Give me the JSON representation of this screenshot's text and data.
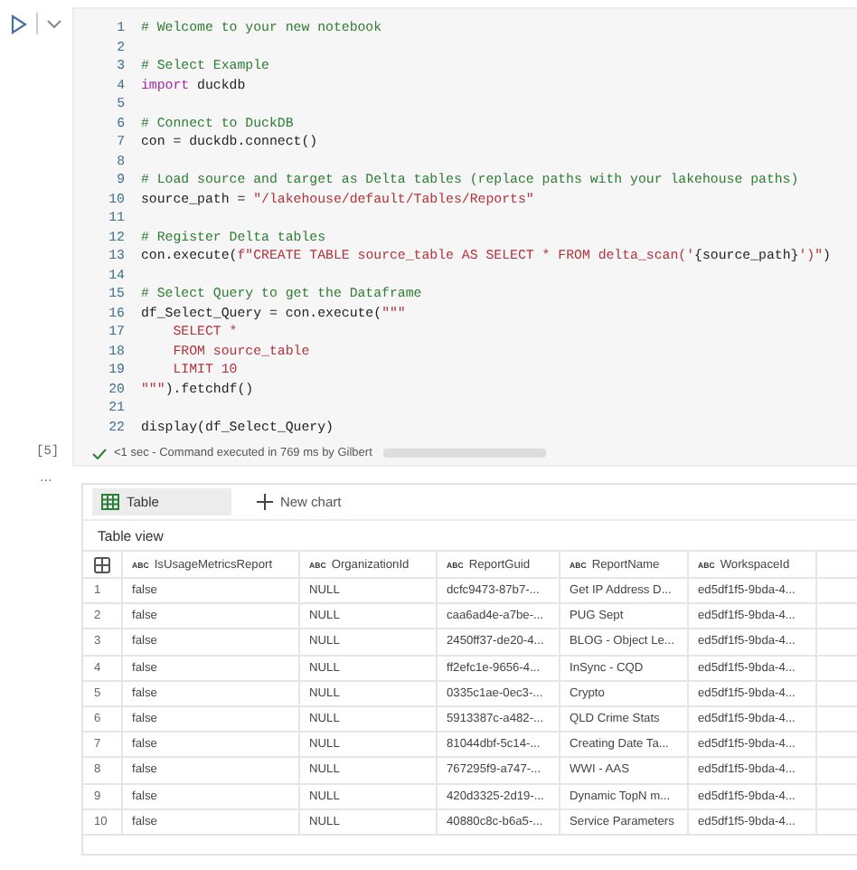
{
  "code_cell": {
    "execution_count": "[5]",
    "lines": [
      {
        "number": "1",
        "tokens": [
          {
            "kind": "comment",
            "text": "# Welcome to your new notebook"
          }
        ]
      },
      {
        "number": "2"
      },
      {
        "number": "3",
        "tokens": [
          {
            "kind": "comment",
            "text": "# Select Example"
          }
        ]
      },
      {
        "number": "4",
        "tokens": [
          {
            "kind": "keyword",
            "text": "import"
          },
          {
            "kind": "plain",
            "text": " duckdb"
          }
        ]
      },
      {
        "number": "5"
      },
      {
        "number": "6",
        "tokens": [
          {
            "kind": "comment",
            "text": "# Connect to DuckDB"
          }
        ]
      },
      {
        "number": "7",
        "tokens": [
          {
            "kind": "plain",
            "text": "con = duckdb.connect()"
          }
        ]
      },
      {
        "number": "8"
      },
      {
        "number": "9",
        "tokens": [
          {
            "kind": "comment",
            "text": "# Load source and target as Delta tables (replace paths with your lakehouse paths)"
          }
        ]
      },
      {
        "number": "10",
        "tokens": [
          {
            "kind": "plain",
            "text": "source_path = "
          },
          {
            "kind": "string",
            "text": "\"/lakehouse/default/Tables/Reports\""
          }
        ]
      },
      {
        "number": "11"
      },
      {
        "number": "12",
        "tokens": [
          {
            "kind": "comment",
            "text": "# Register Delta tables"
          }
        ]
      },
      {
        "number": "13",
        "tokens": [
          {
            "kind": "plain",
            "text": "con.execute("
          },
          {
            "kind": "string",
            "text": "f\"CREATE TABLE source_table AS SELECT * FROM delta_scan('"
          },
          {
            "kind": "plain",
            "text": "{source_path}"
          },
          {
            "kind": "string",
            "text": "')\""
          },
          {
            "kind": "plain",
            "text": ")"
          }
        ]
      },
      {
        "number": "14"
      },
      {
        "number": "15",
        "tokens": [
          {
            "kind": "comment",
            "text": "# Select Query to get the Dataframe"
          }
        ]
      },
      {
        "number": "16",
        "tokens": [
          {
            "kind": "plain",
            "text": "df_Select_Query = con.execute("
          },
          {
            "kind": "string",
            "text": "\"\"\""
          }
        ]
      },
      {
        "number": "17",
        "tokens": [
          {
            "kind": "string",
            "text": "    SELECT *"
          }
        ]
      },
      {
        "number": "18",
        "tokens": [
          {
            "kind": "string",
            "text": "    FROM source_table"
          }
        ]
      },
      {
        "number": "19",
        "tokens": [
          {
            "kind": "string",
            "text": "    LIMIT 10"
          }
        ]
      },
      {
        "number": "20",
        "tokens": [
          {
            "kind": "string",
            "text": "\"\"\""
          },
          {
            "kind": "plain",
            "text": ").fetchdf()"
          }
        ]
      },
      {
        "number": "21"
      },
      {
        "number": "22",
        "tokens": [
          {
            "kind": "plain",
            "text": "display(df_Select_Query)"
          }
        ]
      }
    ],
    "status": "<1 sec - Command executed in 769 ms by Gilbert"
  },
  "output": {
    "more": "...",
    "view_tabs": [
      {
        "label": "Table",
        "selected": true
      }
    ],
    "new_chart": "New chart",
    "title": "Table view",
    "table": {
      "columns": [
        {
          "type": "ABC",
          "name": "IsUsageMetricsReport"
        },
        {
          "type": "ABC",
          "name": "OrganizationId"
        },
        {
          "type": "ABC",
          "name": "ReportGuid"
        },
        {
          "type": "ABC",
          "name": "ReportName"
        },
        {
          "type": "ABC",
          "name": "WorkspaceId"
        }
      ],
      "rows": [
        {
          "index": "1",
          "cells": [
            "false",
            "NULL",
            "dcfc9473-87b7-...",
            "Get IP Address D...",
            "ed5df1f5-9bda-4..."
          ]
        },
        {
          "index": "2",
          "cells": [
            "false",
            "NULL",
            "caa6ad4e-a7be-...",
            "PUG Sept",
            "ed5df1f5-9bda-4..."
          ]
        },
        {
          "index": "3",
          "cells": [
            "false",
            "NULL",
            "2450ff37-de20-4...",
            "BLOG - Object Le...",
            "ed5df1f5-9bda-4..."
          ]
        },
        {
          "index": "4",
          "cells": [
            "false",
            "NULL",
            "ff2efc1e-9656-4...",
            "InSync - CQD",
            "ed5df1f5-9bda-4..."
          ]
        },
        {
          "index": "5",
          "cells": [
            "false",
            "NULL",
            "0335c1ae-0ec3-...",
            "Crypto",
            "ed5df1f5-9bda-4..."
          ]
        },
        {
          "index": "6",
          "cells": [
            "false",
            "NULL",
            "5913387c-a482-...",
            "QLD Crime Stats",
            "ed5df1f5-9bda-4..."
          ]
        },
        {
          "index": "7",
          "cells": [
            "false",
            "NULL",
            "81044dbf-5c14-...",
            "Creating Date Ta...",
            "ed5df1f5-9bda-4..."
          ]
        },
        {
          "index": "8",
          "cells": [
            "false",
            "NULL",
            "767295f9-a747-...",
            "WWI - AAS",
            "ed5df1f5-9bda-4..."
          ]
        },
        {
          "index": "9",
          "cells": [
            "false",
            "NULL",
            "420d3325-2d19-...",
            "Dynamic TopN m...",
            "ed5df1f5-9bda-4..."
          ]
        },
        {
          "index": "10",
          "cells": [
            "false",
            "NULL",
            "40880c8c-b6a5-...",
            "Service Parameters",
            "ed5df1f5-9bda-4..."
          ]
        }
      ]
    }
  }
}
